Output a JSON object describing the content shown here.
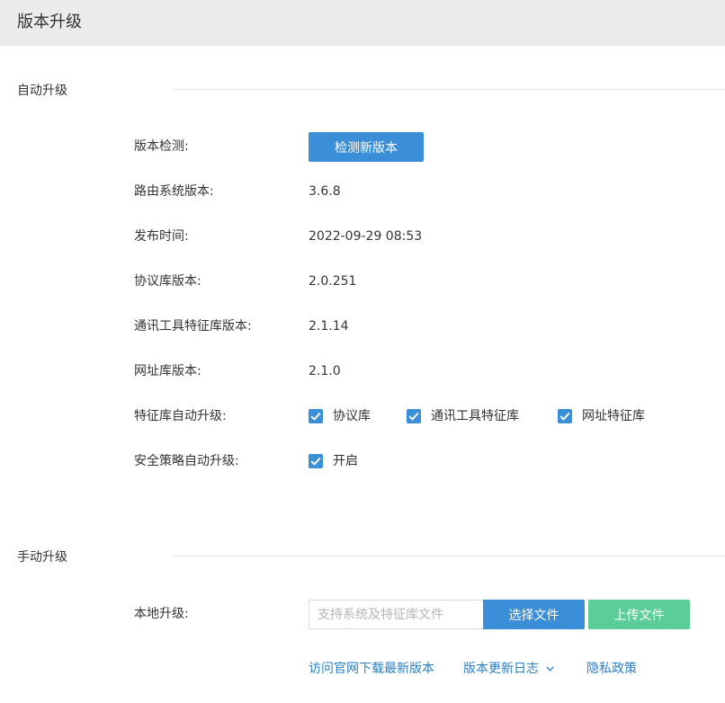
{
  "header": {
    "title": "版本升级"
  },
  "auto_upgrade": {
    "section_title": "自动升级",
    "version_check": {
      "label": "版本检测:",
      "button": "检测新版本"
    },
    "rows": [
      {
        "label": "路由系统版本:",
        "value": "3.6.8"
      },
      {
        "label": "发布时间:",
        "value": "2022-09-29 08:53"
      },
      {
        "label": "协议库版本:",
        "value": "2.0.251"
      },
      {
        "label": "通讯工具特征库版本:",
        "value": "2.1.14"
      },
      {
        "label": "网址库版本:",
        "value": "2.1.0"
      }
    ],
    "feature_auto": {
      "label": "特征库自动升级:",
      "options": [
        {
          "label": "协议库",
          "checked": true
        },
        {
          "label": "通讯工具特征库",
          "checked": true
        },
        {
          "label": "网址特征库",
          "checked": true
        }
      ]
    },
    "security_auto": {
      "label": "安全策略自动升级:",
      "option": {
        "label": "开启",
        "checked": true
      }
    }
  },
  "manual_upgrade": {
    "section_title": "手动升级",
    "local": {
      "label": "本地升级:",
      "input_value": "",
      "input_placeholder": "支持系统及特征库文件",
      "select_button": "选择文件",
      "upload_button": "上传文件"
    },
    "links": {
      "official_download": "访问官网下载最新版本",
      "changelog": "版本更新日志",
      "privacy": "隐私政策"
    }
  },
  "colors": {
    "primary": "#3b8fd8",
    "upload": "#5ccc98",
    "link": "#2a7fc4",
    "header_bg": "#ebebeb"
  },
  "icons": {
    "checkbox": "checkmark-icon",
    "changelog_toggle": "chevron-down-icon"
  }
}
